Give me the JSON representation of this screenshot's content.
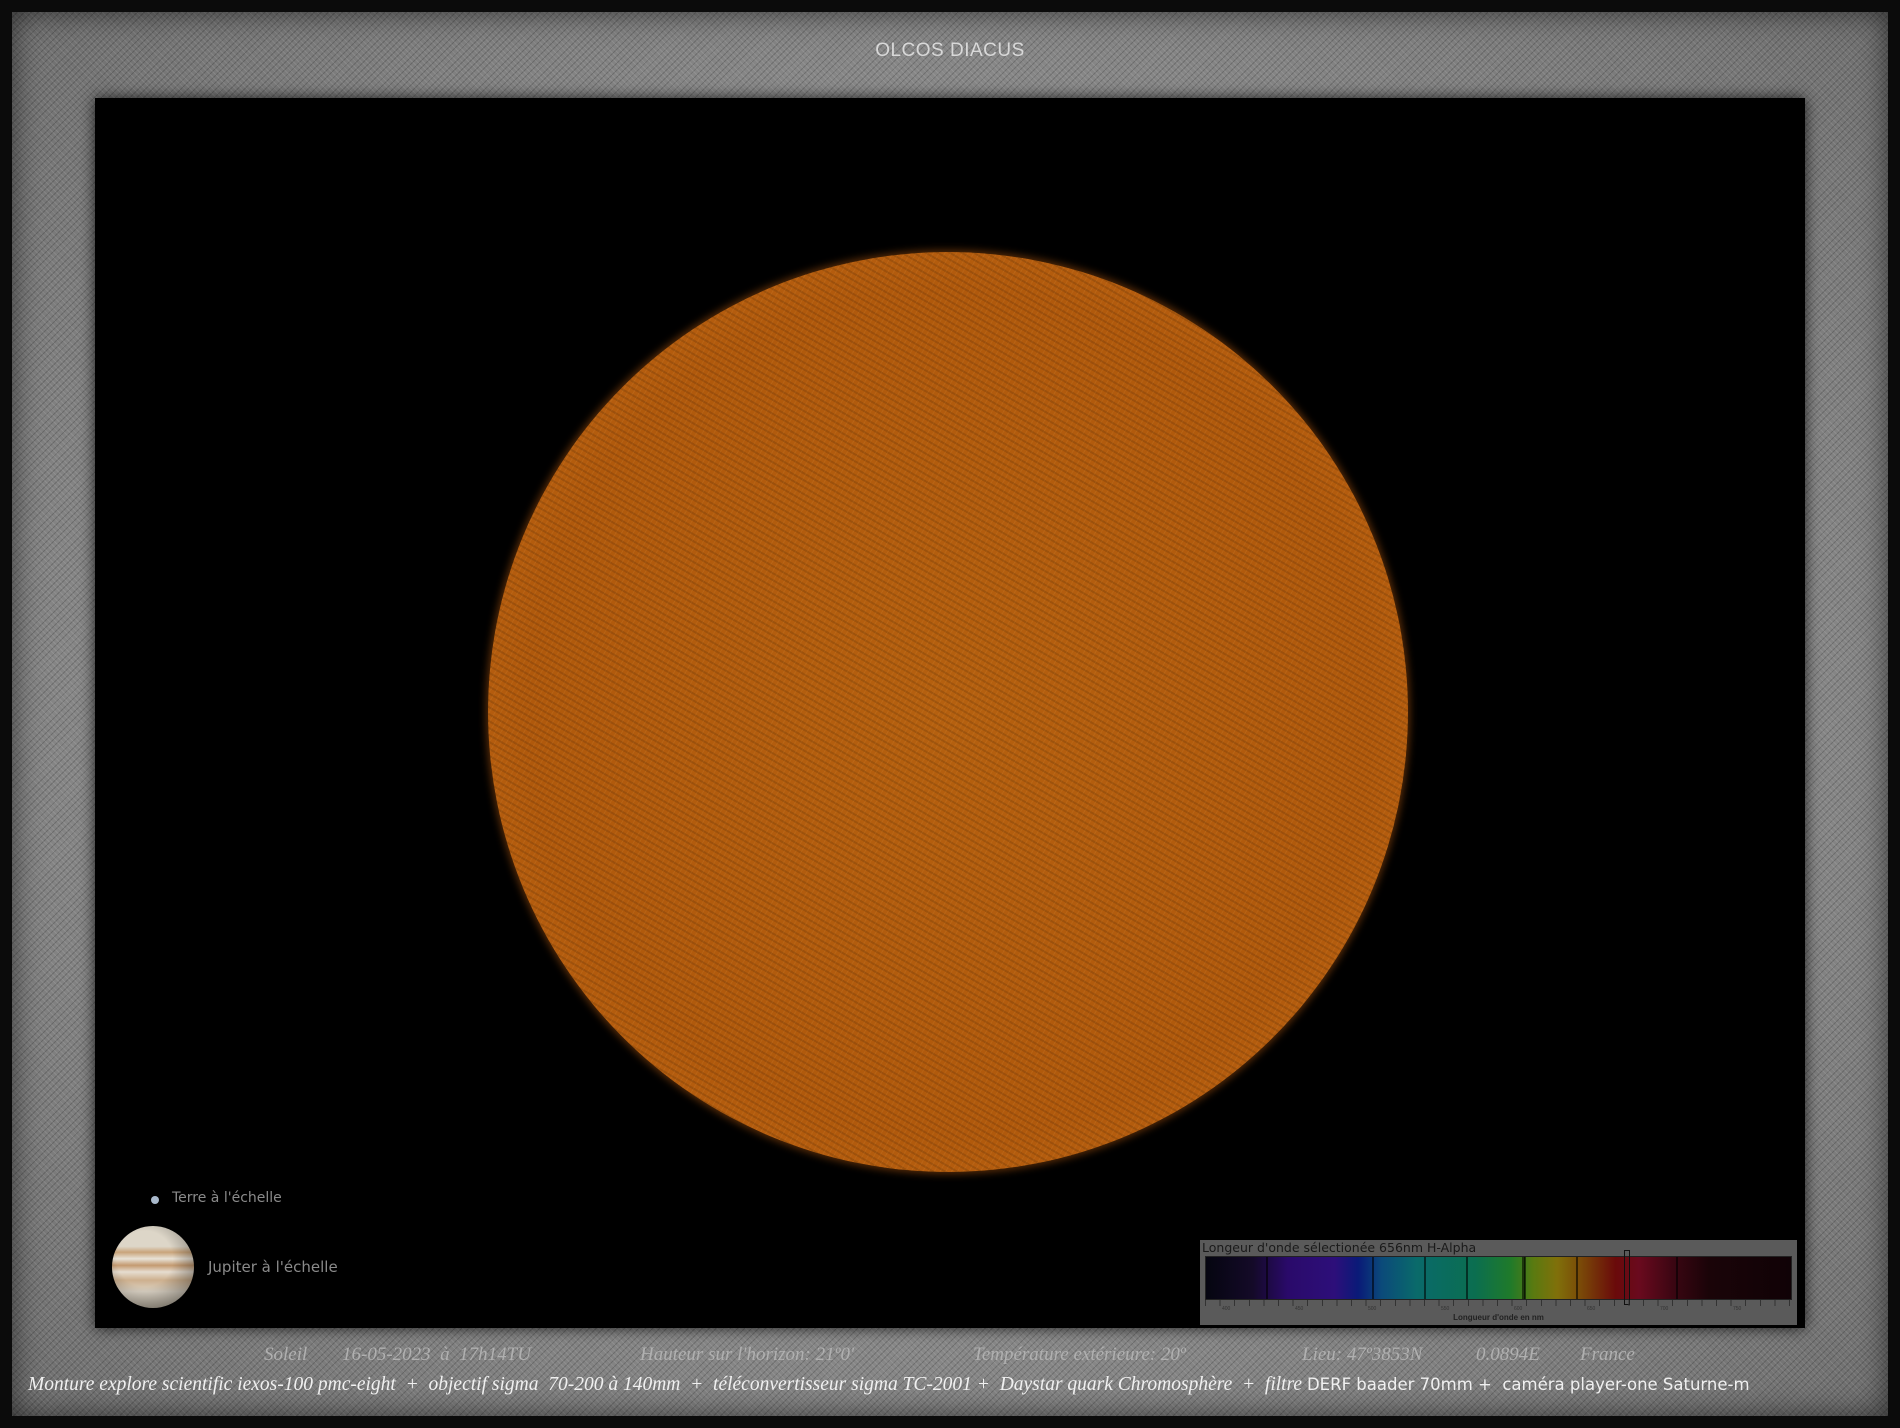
{
  "title": "OLCOS DIACUS",
  "legend": {
    "earth": "Terre à l'échelle",
    "jupiter": "Jupiter à l'échelle"
  },
  "spectrum": {
    "title": "Longeur d'onde sélectionée 656nm H-Alpha",
    "selected_nm": 656,
    "ticks": [
      "400",
      "450",
      "500",
      "550",
      "600",
      "650",
      "700",
      "750"
    ],
    "axis_label": "Longueur d'onde en nm"
  },
  "info": {
    "object": "Soleil",
    "date": "16-05-2023  à  17h14TU",
    "altitude": "Hauteur sur l'horizon: 21º0'",
    "temperature": "Température extérieure: 20º",
    "location": "Lieu: 47º3853N",
    "longitude": "0.0894E",
    "country": "France"
  },
  "equipment": {
    "italic": "Monture explore scientific iexos-100 pmc-eight  +  objectif sigma  70-200 à 140mm  +  téléconvertisseur sigma TC-2001 +  Daystar quark Chromosphère  +  filtre ",
    "plain": "DERF baader 70mm +  caméra player-one Saturne-m"
  }
}
